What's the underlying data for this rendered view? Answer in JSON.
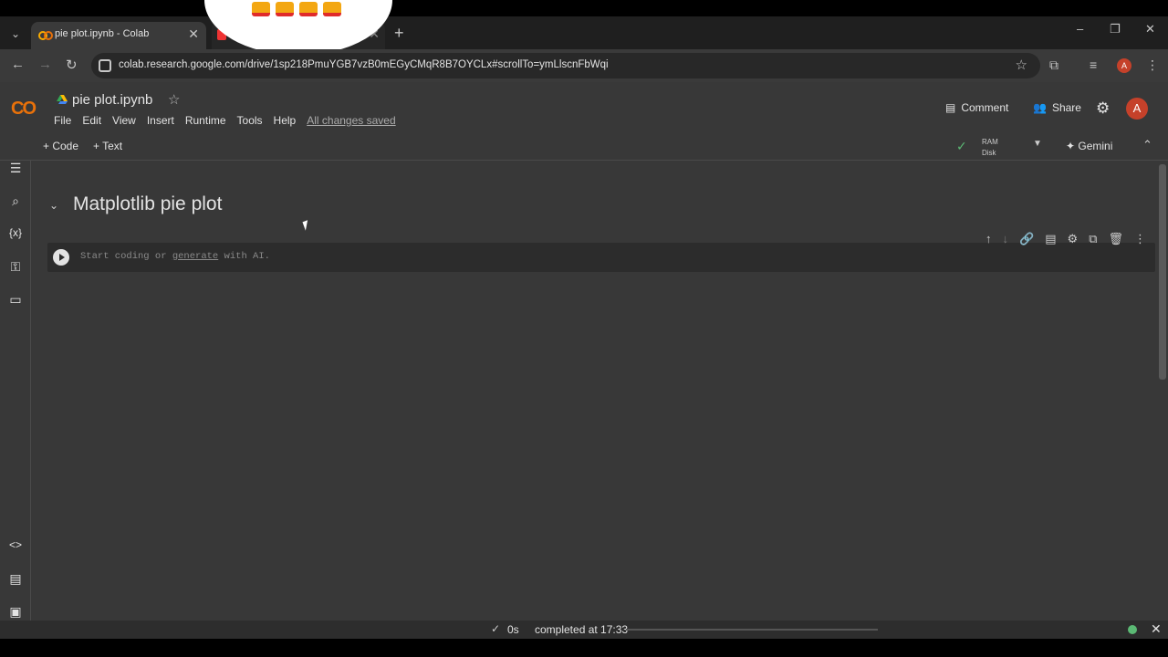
{
  "browser": {
    "tabs": [
      {
        "title": "pie plot.ipynb - Colab",
        "close": "✕"
      },
      {
        "title": "",
        "close": "✕"
      }
    ],
    "new_tab": "+",
    "url": "colab.research.google.com/drive/1sp218PmuYGB7vzB0mEGyCMqR8B7OYCLx#scrollTo=ymLlscnFbWqi",
    "profile_initial": "A"
  },
  "colab": {
    "logo": "CO",
    "notebook_title": "pie plot.ipynb",
    "menu": [
      "File",
      "Edit",
      "View",
      "Insert",
      "Runtime",
      "Tools",
      "Help"
    ],
    "save_status": "All changes saved",
    "comment_label": "Comment",
    "share_label": "Share",
    "profile_initial": "A",
    "add_code": "+ Code",
    "add_text": "+ Text",
    "ram_label": "RAM",
    "disk_label": "Disk",
    "gemini_label": "Gemini"
  },
  "notebook": {
    "section_title": "Matplotlib pie plot",
    "cell_placeholder_prefix": "Start coding or ",
    "cell_placeholder_link": "generate",
    "cell_placeholder_suffix": " with AI."
  },
  "status": {
    "exec_time": "0s",
    "completed": "completed at 17:33"
  }
}
